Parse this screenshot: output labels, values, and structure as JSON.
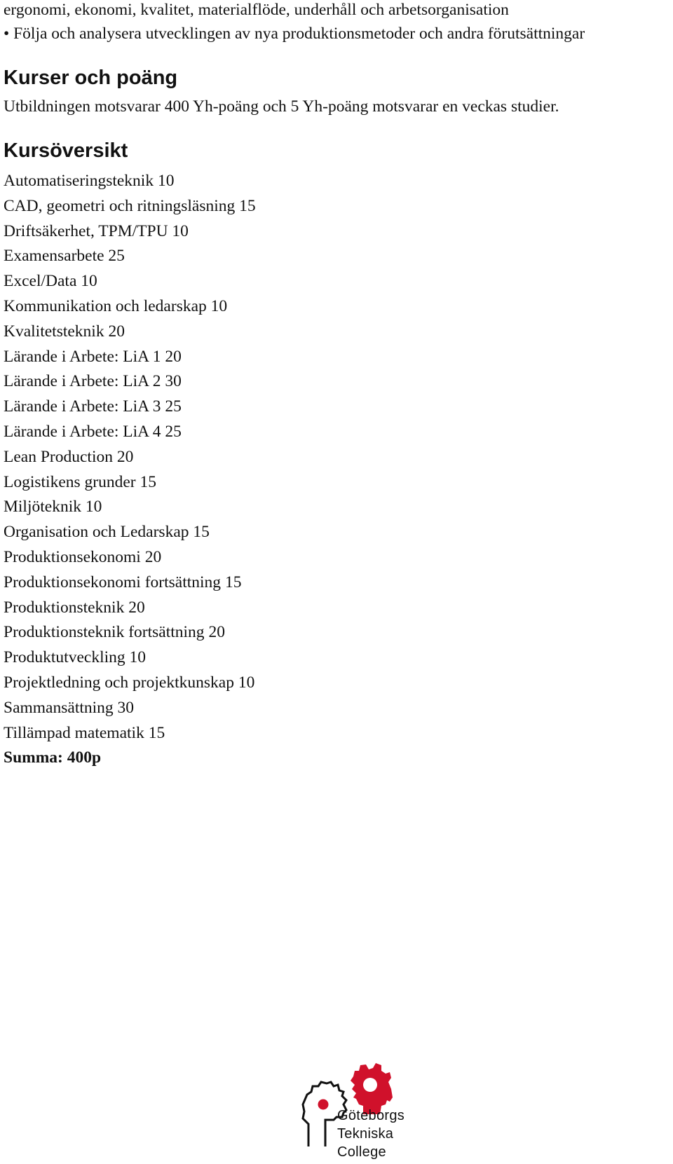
{
  "intro_lines": [
    "ergonomi, ekonomi, kvalitet, materialflöde, underhåll och arbetsorganisation",
    "• Följa och analysera utvecklingen av nya produktionsmetoder och andra förutsättningar"
  ],
  "credits_section": {
    "heading": "Kurser och poäng",
    "text": "Utbildningen motsvarar 400 Yh-poäng och 5 Yh-poäng motsvarar en veckas studier."
  },
  "overview_section": {
    "heading": "Kursöversikt",
    "courses": [
      {
        "name": "Automatiseringsteknik",
        "points": "10"
      },
      {
        "name": "CAD, geometri och ritningsläsning",
        "points": "15"
      },
      {
        "name": "Driftsäkerhet, TPM/TPU",
        "points": "10"
      },
      {
        "name": "Examensarbete",
        "points": "25"
      },
      {
        "name": "Excel/Data",
        "points": "10"
      },
      {
        "name": "Kommunikation och ledarskap",
        "points": "10"
      },
      {
        "name": "Kvalitetsteknik",
        "points": "20"
      },
      {
        "name": "Lärande i Arbete: LiA 1",
        "points": "20"
      },
      {
        "name": "Lärande i Arbete: LiA 2",
        "points": "30"
      },
      {
        "name": "Lärande i Arbete: LiA 3",
        "points": "25"
      },
      {
        "name": "Lärande i Arbete: LiA 4",
        "points": "25"
      },
      {
        "name": "Lean Production",
        "points": "20"
      },
      {
        "name": "Logistikens grunder",
        "points": "15"
      },
      {
        "name": "Miljöteknik",
        "points": "10"
      },
      {
        "name": "Organisation och Ledarskap",
        "points": "15"
      },
      {
        "name": "Produktionsekonomi",
        "points": "20"
      },
      {
        "name": "Produktionsekonomi fortsättning",
        "points": "15"
      },
      {
        "name": "Produktionsteknik",
        "points": "20"
      },
      {
        "name": "Produktionsteknik fortsättning",
        "points": "20"
      },
      {
        "name": "Produktutveckling",
        "points": "10"
      },
      {
        "name": "Projektledning och projektkunskap",
        "points": "10"
      },
      {
        "name": "Sammansättning",
        "points": "30"
      },
      {
        "name": "Tillämpad matematik",
        "points": "15"
      }
    ],
    "sum": "Summa: 400p"
  },
  "logo": {
    "icon": "gear-heads-logo-icon",
    "lines": [
      "Göteborgs",
      "Tekniska",
      "College"
    ],
    "accent_color": "#d0112b",
    "outline_color": "#111111"
  }
}
